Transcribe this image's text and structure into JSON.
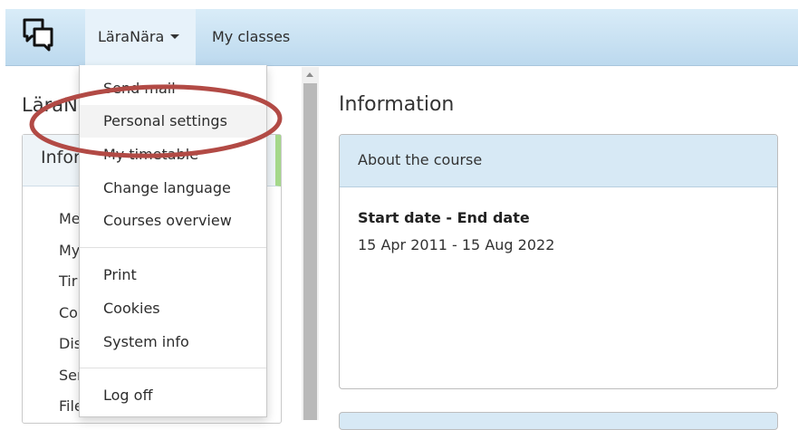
{
  "nav": {
    "items": [
      {
        "label": "LäraNära"
      },
      {
        "label": "My classes"
      }
    ]
  },
  "left": {
    "heading": "LäraN",
    "panel_title": "Infor",
    "list": [
      "Me",
      "My",
      "Tir",
      "Co",
      "Dis",
      "Ser",
      "File"
    ]
  },
  "main": {
    "heading": "Information",
    "panel_title": "About the course",
    "date_label": "Start date - End date",
    "date_value": "15 Apr 2011 - 15 Aug 2022"
  },
  "dropdown": {
    "group1": [
      "Send mail",
      "Personal settings",
      "My timetable",
      "Change language",
      "Courses overview"
    ],
    "group2": [
      "Print",
      "Cookies",
      "System info"
    ],
    "group3": [
      "Log off"
    ]
  },
  "colors": {
    "navbar": "#c9e2f3",
    "panel_header": "#d7e9f5",
    "annotation": "#b24a45",
    "accent_green": "#a5d88b"
  }
}
